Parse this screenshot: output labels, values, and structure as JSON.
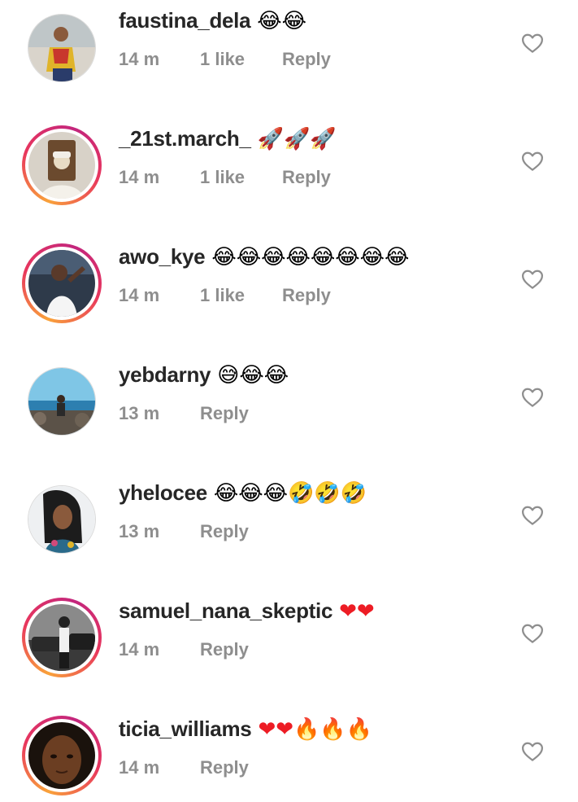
{
  "comments": [
    {
      "username": "faustina_dela",
      "emojis": "😂😂",
      "time": "14 m",
      "likes": "1 like",
      "reply": "Reply"
    },
    {
      "username": "_21st.march_",
      "emojis": "🚀🚀🚀",
      "time": "14 m",
      "likes": "1 like",
      "reply": "Reply"
    },
    {
      "username": "awo_kye",
      "emojis": "😂😂😂😂😂😂😂😂",
      "time": "14 m",
      "likes": "1 like",
      "reply": "Reply"
    },
    {
      "username": "yebdarny",
      "emojis": "😅😂😂",
      "time": "13 m",
      "likes": "",
      "reply": "Reply"
    },
    {
      "username": "yhelocee",
      "emojis": "😂😂😂🤣🤣🤣",
      "time": "13 m",
      "likes": "",
      "reply": "Reply"
    },
    {
      "username": "samuel_nana_skeptic",
      "emojis": "❤❤",
      "time": "14 m",
      "likes": "",
      "reply": "Reply"
    },
    {
      "username": "ticia_williams",
      "emojis": "❤❤🔥🔥🔥",
      "time": "14 m",
      "likes": "",
      "reply": "Reply"
    }
  ],
  "colors": {
    "username": "#262626",
    "meta": "#8e8e8e",
    "heart_outline": "#8e8e8e",
    "emoji_heart": "#ed1c24"
  },
  "icons": {
    "like": "heart-outline-icon"
  }
}
